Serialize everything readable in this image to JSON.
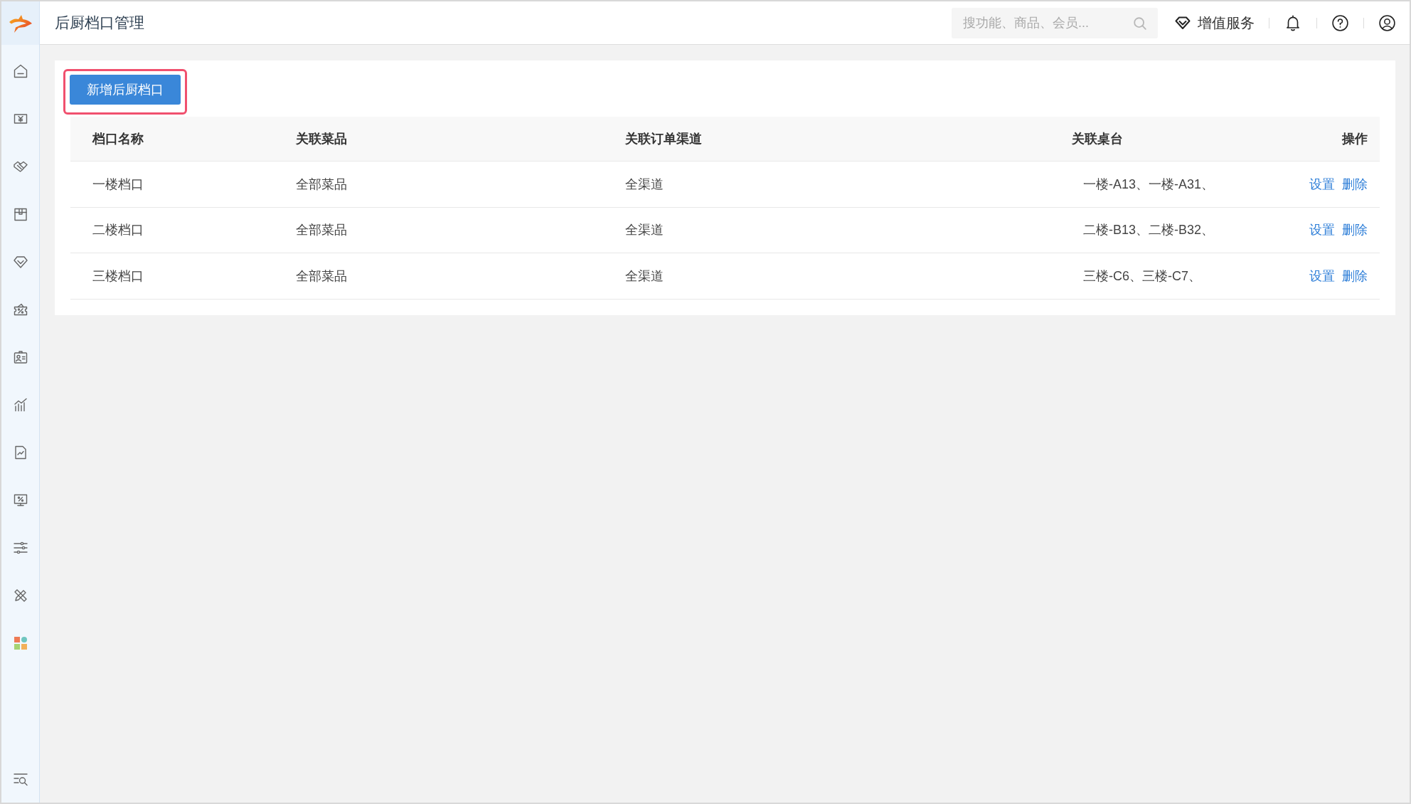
{
  "header": {
    "title": "后厨档口管理",
    "search": {
      "placeholder": "搜功能、商品、会员..."
    },
    "services_link": "增值服务"
  },
  "toolbar": {
    "add_button": {
      "label": "新增后厨档口",
      "highlighted": true
    }
  },
  "table": {
    "columns": [
      "档口名称",
      "关联菜品",
      "关联订单渠道",
      "关联桌台",
      "操作"
    ],
    "rows": [
      {
        "cells": [
          "一楼档口",
          "全部菜品",
          "全渠道",
          "一楼-A13、一楼-A31、"
        ],
        "actions": [
          "设置",
          "删除"
        ]
      },
      {
        "cells": [
          "二楼档口",
          "全部菜品",
          "全渠道",
          "二楼-B13、二楼-B32、"
        ],
        "actions": [
          "设置",
          "删除"
        ]
      },
      {
        "cells": [
          "三楼档口",
          "全部菜品",
          "全渠道",
          "三楼-C6、三楼-C7、"
        ],
        "actions": [
          "设置",
          "删除"
        ]
      }
    ]
  }
}
